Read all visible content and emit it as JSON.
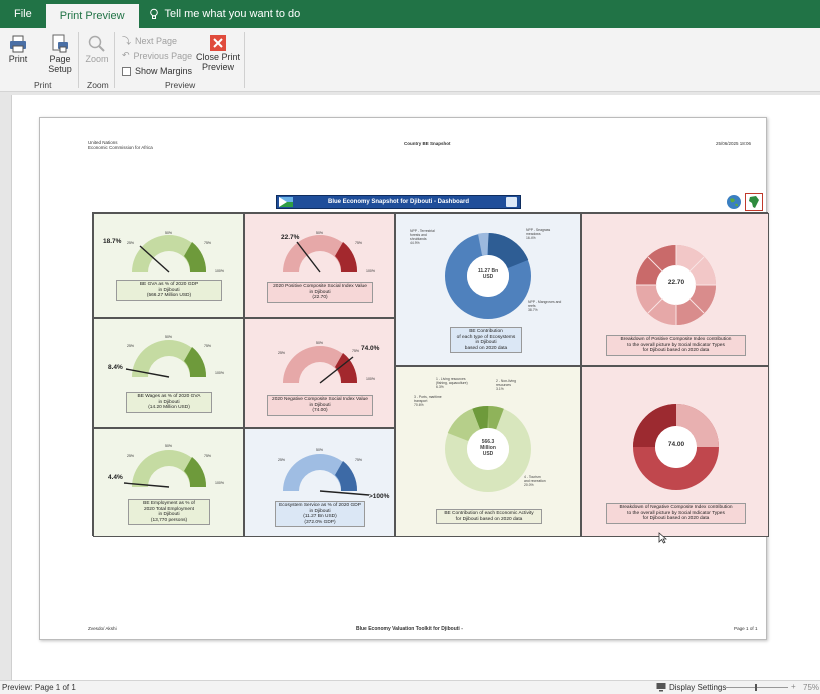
{
  "tabs": [
    {
      "label": "File"
    },
    {
      "label": "Print Preview"
    }
  ],
  "tell_me": "Tell me what you want to do",
  "ribbon": {
    "print": "Print",
    "page_setup_1": "Page",
    "page_setup_2": "Setup",
    "zoom": "Zoom",
    "next_page": "Next Page",
    "previous_page": "Previous Page",
    "show_margins": "Show Margins",
    "close_1": "Close Print",
    "close_2": "Preview",
    "group_print": "Print",
    "group_zoom": "Zoom",
    "group_preview": "Preview"
  },
  "page_header": {
    "org_1": "United Nations",
    "org_2": "Economic Commission for Africa",
    "title": "Country BE Snapshot",
    "date": "25/06/2025 18:06"
  },
  "banner": "Blue Economy Snapshot for Djibouti - Dashboard",
  "gauges": {
    "bva": {
      "value": "18.7%",
      "cap": [
        "BE GVA as % of 2020 GDP",
        "in Djibouti",
        "(566.27 Million USD)"
      ]
    },
    "wages": {
      "value": "8.4%",
      "cap": [
        "BE Wages as % of 2020 GVA",
        "in Djibouti",
        "(14.20 Million USD)"
      ]
    },
    "employment": {
      "value": "4.4%",
      "cap": [
        "BE Employment as % of",
        "2020 Total Employment",
        "in Djibouti",
        "(13,770 persons)"
      ]
    },
    "psi": {
      "value": "22.7%",
      "cap": [
        "2020 Positive Composite Social Index Value",
        "in Djibouti",
        "(22.70)"
      ]
    },
    "nsi": {
      "value": "74.0%",
      "cap": [
        "2020 Negative Composite Social Index Value",
        "in Djibouti",
        "(74.00)"
      ]
    },
    "eco": {
      "value": ">100%",
      "cap": [
        "Ecosystem Service as % of 2020 GDP",
        "in Djibouti",
        "(11.27 Bn USD)",
        "(372.0% GDP)"
      ]
    }
  },
  "gauge_ticks": [
    "0%",
    "25%",
    "50%",
    "75%",
    "100%"
  ],
  "donut_eco": {
    "center": [
      "11.27 Bn",
      "USD"
    ],
    "labels": [
      "NPP - Terrestrial",
      "forests and",
      "shrublands",
      "44.9%",
      "NPP - Seagrass",
      "meadows",
      "16.4%",
      "NPP - Mangroves and",
      "reefs",
      "38.7%"
    ],
    "cap": [
      "BE Contribution",
      "of each type of Ecosystems",
      "in Djibouti",
      "based on 2020 data"
    ]
  },
  "donut_sector": {
    "center": [
      "566.3",
      "Million",
      "USD"
    ],
    "labels": [
      "1 - Living resources",
      "(fishing, aquaculture)",
      "6.3%",
      "2 - Non-living",
      "resources",
      "3.1%",
      "3 - Ports, maritime",
      "transport",
      "70.6%",
      "4 - Tourism",
      "and recreation",
      "20.0%"
    ],
    "cap": [
      "BE Contribution of each Economic Activity",
      "for Djibouti based on 2020 data"
    ]
  },
  "donut_psi": {
    "center": "22.70",
    "cap": [
      "Breakdown of Positive Composite Index contribution",
      "to the overall picture by Social Indicator Types",
      "for Djibouti based on 2020 data"
    ]
  },
  "donut_nsi": {
    "center": "74.00",
    "cap": [
      "Breakdown of Negative Composite Index contribution",
      "to the overall picture by Social Indicator Types",
      "for Djibouti based on 2020 data"
    ]
  },
  "page_footer": {
    "left": "Zvesdo/ Akshi",
    "center": "Blue Economy Valuation Toolkit for Djibouti -",
    "right": "Page 1 of 1"
  },
  "status": {
    "left": "Preview: Page 1 of 1",
    "display": "Display Settings",
    "zoom": "75%"
  },
  "colors": {
    "excel_green": "#217346",
    "gauge_green_light": "#c5dba2",
    "gauge_green_dark": "#6e9a3b",
    "gauge_red_light": "#e6a8a8",
    "gauge_red_dark": "#a3282d",
    "gauge_blue_light": "#9fbde3",
    "gauge_blue_dark": "#3d6aa6",
    "donut_blue": "#4f81bd"
  }
}
